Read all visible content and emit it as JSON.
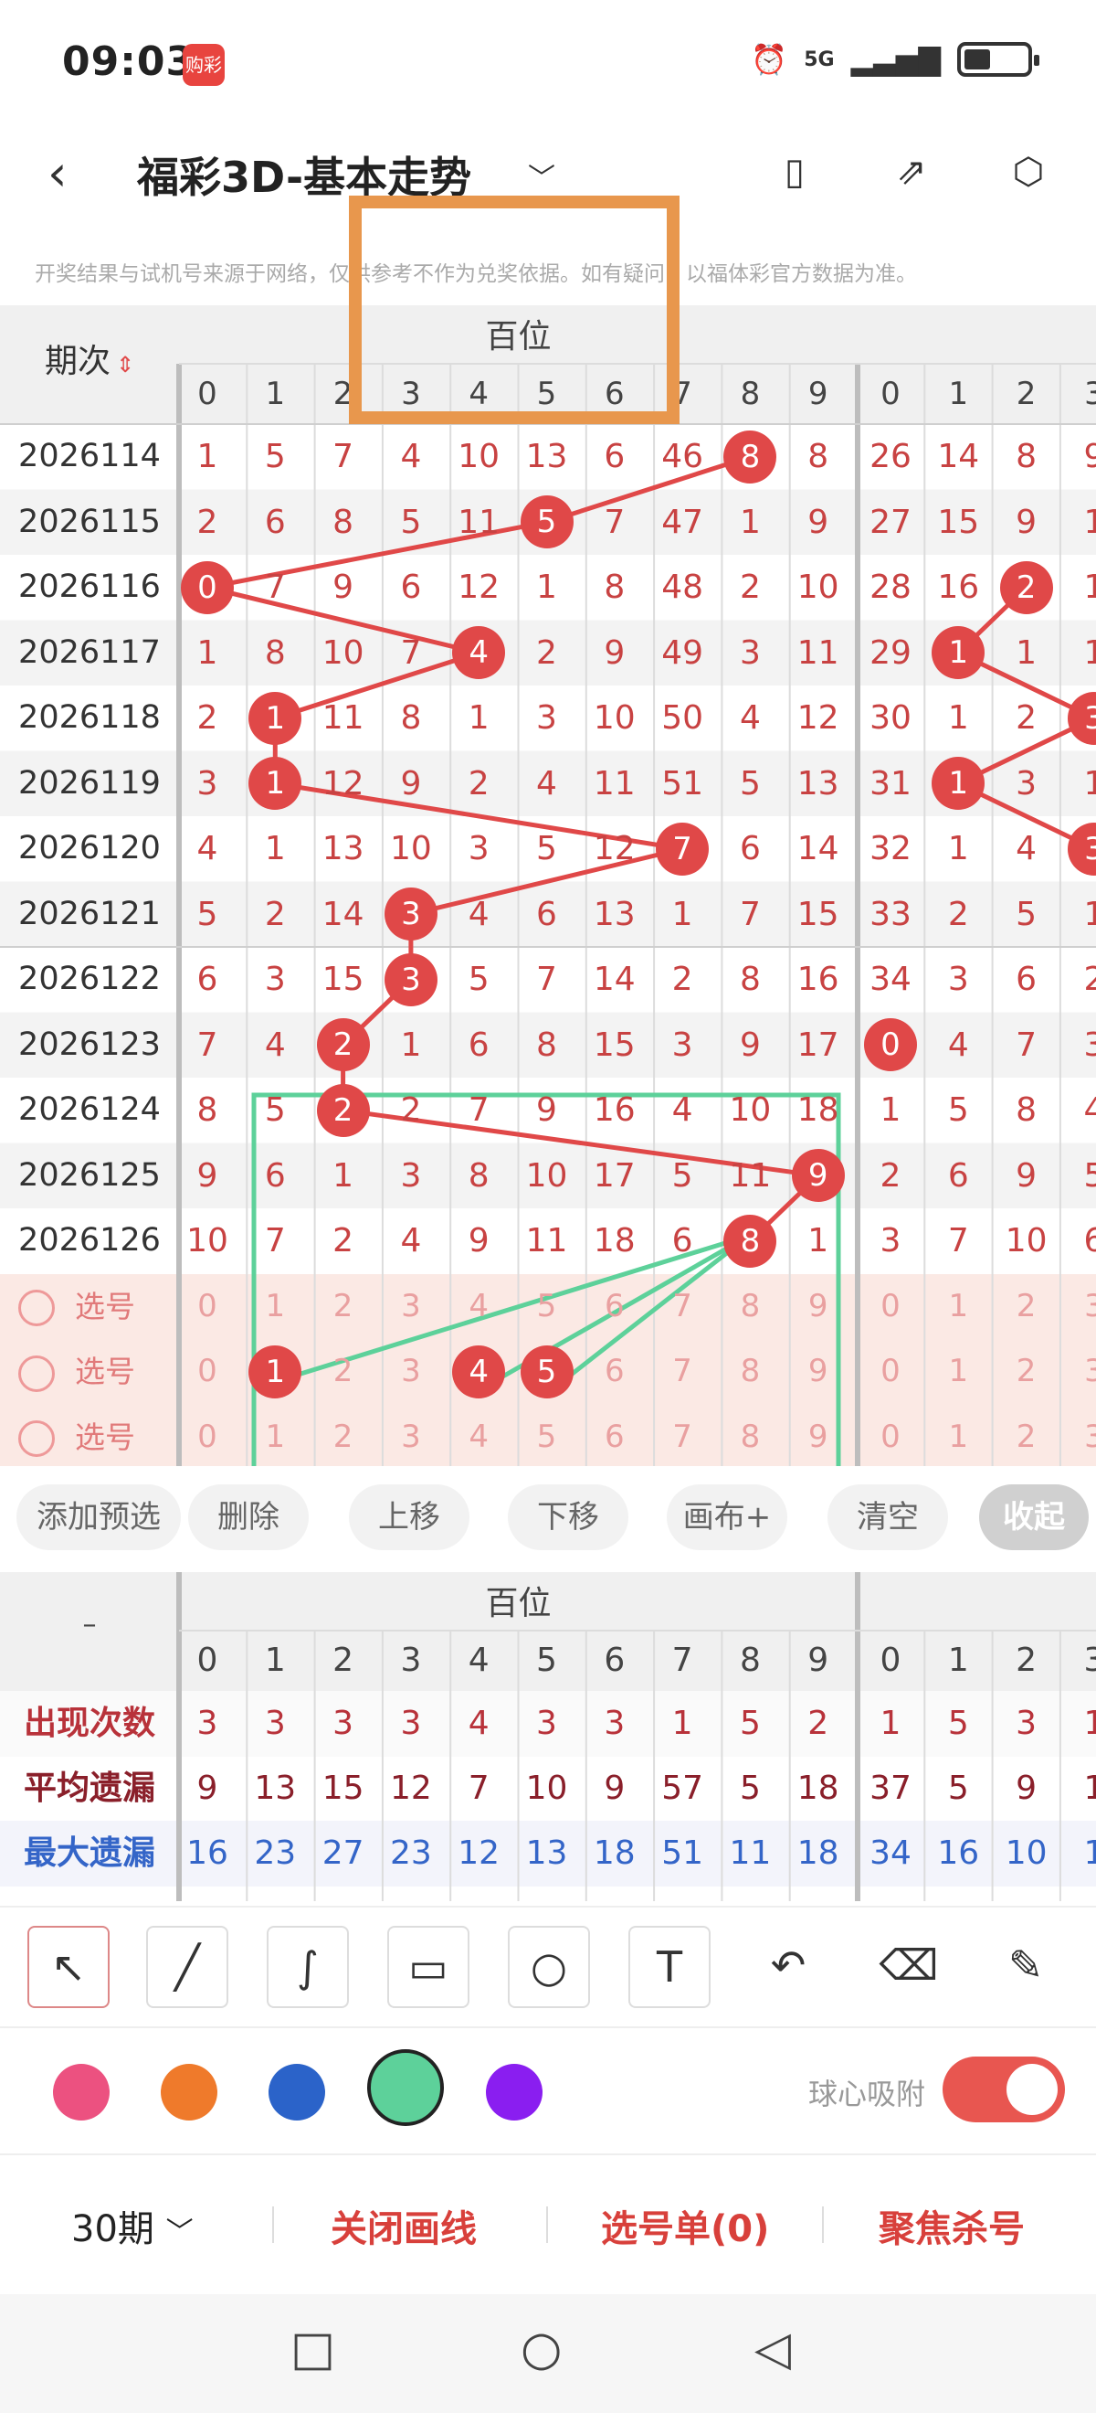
{
  "status": {
    "time": "09:03",
    "app_badge": "购彩",
    "alarm_icon": "alarm-icon",
    "network": "5G",
    "signal_icon": "signal-icon",
    "battery_icon": "battery-icon"
  },
  "header": {
    "title": "福彩3D-基本走势",
    "back_icon": "back-arrow-icon",
    "title_chevron": "chevron-down-icon",
    "actions": [
      "phone-orientation-icon",
      "share-icon",
      "settings-icon"
    ]
  },
  "notice": "开奖结果与试机号来源于网络，仅供参考不作为兑奖依据。如有疑问，以福体彩官方数据为准。",
  "table": {
    "period_header": "期次",
    "sort_icon": "sort-icon",
    "group_label": "百位",
    "digits": [
      "0",
      "1",
      "2",
      "3",
      "4",
      "5",
      "6",
      "7",
      "8",
      "9"
    ],
    "next_digits": [
      "0",
      "1",
      "2",
      "3"
    ],
    "rows": [
      {
        "period": "2026114",
        "vals": [
          "1",
          "5",
          "7",
          "4",
          "10",
          "13",
          "6",
          "46",
          "8",
          "8"
        ],
        "next": [
          "26",
          "14",
          "8",
          "9"
        ],
        "hit": 8,
        "next_hit": -1
      },
      {
        "period": "2026115",
        "vals": [
          "2",
          "6",
          "8",
          "5",
          "11",
          "5",
          "7",
          "47",
          "1",
          "9"
        ],
        "next": [
          "27",
          "15",
          "9",
          "1"
        ],
        "hit": 5,
        "next_hit": -1
      },
      {
        "period": "2026116",
        "vals": [
          "0",
          "7",
          "9",
          "6",
          "12",
          "1",
          "8",
          "48",
          "2",
          "10"
        ],
        "next": [
          "28",
          "16",
          "2",
          "1"
        ],
        "hit": 0,
        "next_hit": 2
      },
      {
        "period": "2026117",
        "vals": [
          "1",
          "8",
          "10",
          "7",
          "4",
          "2",
          "9",
          "49",
          "3",
          "11"
        ],
        "next": [
          "29",
          "1",
          "1",
          "1"
        ],
        "hit": 4,
        "next_hit": 1
      },
      {
        "period": "2026118",
        "vals": [
          "2",
          "1",
          "11",
          "8",
          "1",
          "3",
          "10",
          "50",
          "4",
          "12"
        ],
        "next": [
          "30",
          "1",
          "2",
          "3"
        ],
        "hit": 1,
        "next_hit": 3
      },
      {
        "period": "2026119",
        "vals": [
          "3",
          "1",
          "12",
          "9",
          "2",
          "4",
          "11",
          "51",
          "5",
          "13"
        ],
        "next": [
          "31",
          "1",
          "3",
          "1"
        ],
        "hit": 1,
        "next_hit": 1
      },
      {
        "period": "2026120",
        "vals": [
          "4",
          "1",
          "13",
          "10",
          "3",
          "5",
          "12",
          "7",
          "6",
          "14"
        ],
        "next": [
          "32",
          "1",
          "4",
          "3"
        ],
        "hit": 7,
        "next_hit": 3
      },
      {
        "period": "2026121",
        "vals": [
          "5",
          "2",
          "14",
          "3",
          "4",
          "6",
          "13",
          "1",
          "7",
          "15"
        ],
        "next": [
          "33",
          "2",
          "5",
          "1"
        ],
        "hit": 3,
        "next_hit": -1
      },
      {
        "period": "2026122",
        "vals": [
          "6",
          "3",
          "15",
          "3",
          "5",
          "7",
          "14",
          "2",
          "8",
          "16"
        ],
        "next": [
          "34",
          "3",
          "6",
          "2"
        ],
        "hit": 3,
        "next_hit": -1
      },
      {
        "period": "2026123",
        "vals": [
          "7",
          "4",
          "2",
          "1",
          "6",
          "8",
          "15",
          "3",
          "9",
          "17"
        ],
        "next": [
          "0",
          "4",
          "7",
          "3"
        ],
        "hit": 2,
        "next_hit": 0
      },
      {
        "period": "2026124",
        "vals": [
          "8",
          "5",
          "2",
          "2",
          "7",
          "9",
          "16",
          "4",
          "10",
          "18"
        ],
        "next": [
          "1",
          "5",
          "8",
          "4"
        ],
        "hit": 2,
        "next_hit": -1
      },
      {
        "period": "2026125",
        "vals": [
          "9",
          "6",
          "1",
          "3",
          "8",
          "10",
          "17",
          "5",
          "11",
          "9"
        ],
        "next": [
          "2",
          "6",
          "9",
          "5"
        ],
        "hit": 9,
        "next_hit": -1
      },
      {
        "period": "2026126",
        "vals": [
          "10",
          "7",
          "2",
          "4",
          "9",
          "11",
          "18",
          "6",
          "8",
          "1"
        ],
        "next": [
          "3",
          "7",
          "10",
          "6"
        ],
        "hit": 8,
        "next_hit": -1
      }
    ],
    "select_rows": [
      {
        "label": "选号",
        "picked": []
      },
      {
        "label": "选号",
        "picked": [
          1,
          4,
          5
        ]
      },
      {
        "label": "选号",
        "picked": []
      }
    ]
  },
  "buttons": [
    "添加预选",
    "删除",
    "上移",
    "下移",
    "画布+",
    "清空",
    "收起"
  ],
  "stats": {
    "dash": "–",
    "group_label": "百位",
    "rows": [
      {
        "label": "出现次数",
        "color": "#b8323a",
        "vals": [
          "3",
          "3",
          "3",
          "3",
          "4",
          "3",
          "3",
          "1",
          "5",
          "2"
        ],
        "next": [
          "1",
          "5",
          "3",
          "1"
        ]
      },
      {
        "label": "平均遗漏",
        "color": "#8a1f2a",
        "vals": [
          "9",
          "13",
          "15",
          "12",
          "7",
          "10",
          "9",
          "57",
          "5",
          "18"
        ],
        "next": [
          "37",
          "5",
          "9",
          "1"
        ]
      },
      {
        "label": "最大遗漏",
        "color": "#3465c8",
        "vals": [
          "16",
          "23",
          "27",
          "23",
          "12",
          "13",
          "18",
          "51",
          "11",
          "18"
        ],
        "next": [
          "34",
          "16",
          "10",
          "1"
        ]
      }
    ]
  },
  "tools": [
    "select-arrow-icon",
    "line-icon",
    "curve-icon",
    "rectangle-icon",
    "circle-icon",
    "text-icon",
    "undo-icon",
    "eraser-icon",
    "brush-icon"
  ],
  "palette": {
    "colors": [
      "#ec5180",
      "#ef7a2b",
      "#2b63c9",
      "#5dd19a",
      "#8a1ef0"
    ],
    "selected": "#5dd19a"
  },
  "snap_label": "球心吸附",
  "footer": {
    "periods": "30期",
    "close_lines": "关闭画线",
    "selection": "选号单(0)",
    "focus": "聚焦杀号"
  },
  "nav": [
    "recent-apps-icon",
    "home-icon",
    "back-icon"
  ]
}
